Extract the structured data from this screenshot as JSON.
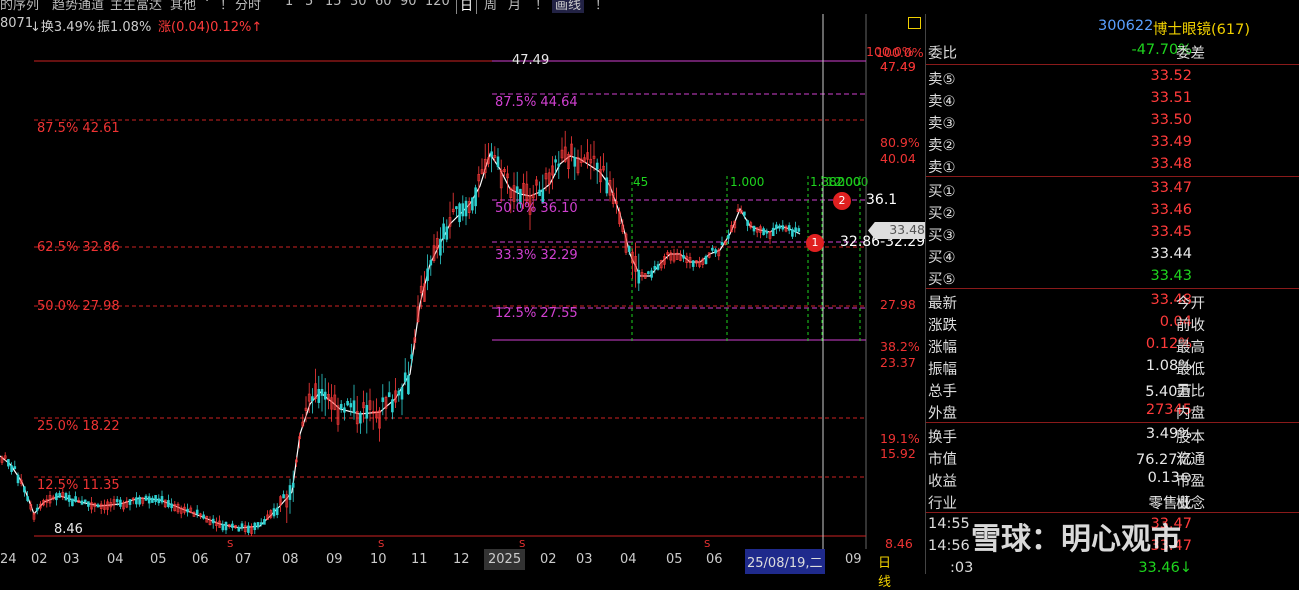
{
  "toolbar": {
    "items": [
      "的序列",
      "趋势通道",
      "主生富达",
      "其他",
      "·",
      "！",
      "分时",
      "1",
      "5",
      "15",
      "30",
      "60",
      "90",
      "120",
      "日",
      "周",
      "月",
      "！",
      "画线",
      "！"
    ]
  },
  "infobar": {
    "code_tail": "8071",
    "turnover": "↓换3.49%",
    "amplitude": "振1.08%",
    "change": "涨(0.04)0.12%↑"
  },
  "chart": {
    "fib_left": [
      {
        "label": "87.5% 42.61"
      },
      {
        "label": "62.5% 32.86"
      },
      {
        "label": "50.0% 27.98"
      },
      {
        "label": "25.0% 18.22"
      },
      {
        "label": "12.5% 11.35"
      }
    ],
    "fib_inner": [
      {
        "label": "47.49"
      },
      {
        "label": "87.5% 44.64"
      },
      {
        "label": "50.0% 36.10"
      },
      {
        "label": "33.3% 32.29"
      },
      {
        "label": "12.5% 27.55"
      }
    ],
    "low_label": "8.46",
    "right_axis": [
      {
        "pct": "100.0%",
        "price": "47.49"
      },
      {
        "pct": "80.9%",
        "price": "40.04"
      },
      {
        "pct": "",
        "price": "33.48"
      },
      {
        "pct": "",
        "price": "27.98"
      },
      {
        "pct": "38.2%",
        "price": "23.37"
      },
      {
        "pct": "19.1%",
        "price": "15.92"
      },
      {
        "pct": "",
        "price": "8.46"
      }
    ],
    "time_marks": [
      "45",
      "1.000",
      "1.382",
      "1.000",
      "2.000"
    ],
    "annotation1": {
      "num": "1",
      "text": "32.86-32.29"
    },
    "annotation2": {
      "num": "2",
      "text": "36.1"
    },
    "x_axis": [
      "24",
      "02",
      "03",
      "04",
      "05",
      "06",
      "07",
      "08",
      "09",
      "10",
      "11",
      "12",
      "2025",
      "02",
      "03",
      "04",
      "05",
      "06",
      "25/08/19,二",
      "09"
    ],
    "period": "日线"
  },
  "quote": {
    "code": "300622",
    "name": "博士眼镜(617)",
    "weibi_label": "委比",
    "weibi_value": "-47.70%",
    "weicha_label": "委差",
    "asks": [
      {
        "label": "卖⑤",
        "price": "33.52"
      },
      {
        "label": "卖④",
        "price": "33.51"
      },
      {
        "label": "卖③",
        "price": "33.50"
      },
      {
        "label": "卖②",
        "price": "33.49"
      },
      {
        "label": "卖①",
        "price": "33.48"
      }
    ],
    "bids": [
      {
        "label": "买①",
        "price": "33.47"
      },
      {
        "label": "买②",
        "price": "33.46"
      },
      {
        "label": "买③",
        "price": "33.45"
      },
      {
        "label": "买④",
        "price": "33.44"
      },
      {
        "label": "买⑤",
        "price": "33.43"
      }
    ],
    "stats1": [
      {
        "k": "最新",
        "v": "33.48",
        "k2": "今开"
      },
      {
        "k": "涨跌",
        "v": "0.04",
        "k2": "前收"
      },
      {
        "k": "涨幅",
        "v": "0.12%",
        "k2": "最高"
      },
      {
        "k": "振幅",
        "v": "1.08%",
        "k2": "最低"
      },
      {
        "k": "总手",
        "v": "5.40万",
        "k2": "量比"
      },
      {
        "k": "外盘",
        "v": "27345",
        "k2": "内盘"
      }
    ],
    "stats2": [
      {
        "k": "换手",
        "v": "3.49%",
        "k2": "股本"
      },
      {
        "k": "市值",
        "v": "76.27亿",
        "k2": "流通"
      },
      {
        "k": "收益",
        "v": "0.13⊙",
        "k2": "市盈"
      },
      {
        "k": "行业",
        "v": "零售业",
        "k2": "概念"
      }
    ],
    "ticks": [
      {
        "t": "14:55",
        "p": "33.47"
      },
      {
        "t": "14:56",
        "p": "33.47"
      },
      {
        "t": ":03",
        "p": "33.46↓"
      }
    ]
  },
  "watermark": "雪球：明心观市",
  "colors": {
    "up": "#ff3b3b",
    "down": "#1ed41e",
    "fib": "#d040d0",
    "level": "#cc2222"
  }
}
